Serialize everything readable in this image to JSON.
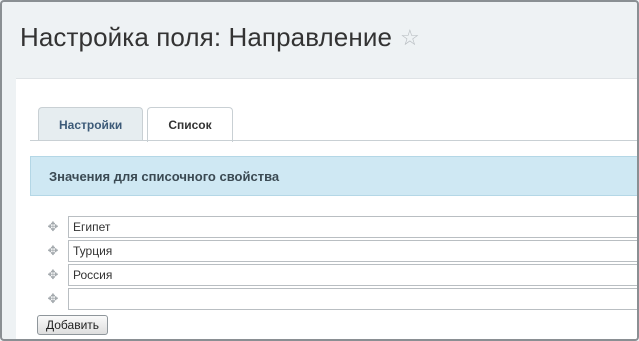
{
  "page": {
    "title": "Настройка поля: Направление",
    "star_icon": "☆"
  },
  "tabs": [
    {
      "label": "Настройки",
      "active": false
    },
    {
      "label": "Список",
      "active": true
    }
  ],
  "section": {
    "heading": "Значения для списочного свойства"
  },
  "list_values": [
    {
      "value": "Египет"
    },
    {
      "value": "Турция"
    },
    {
      "value": "Россия"
    },
    {
      "value": ""
    }
  ],
  "drag_icon": "✥",
  "buttons": {
    "add_label": "Добавить"
  }
}
